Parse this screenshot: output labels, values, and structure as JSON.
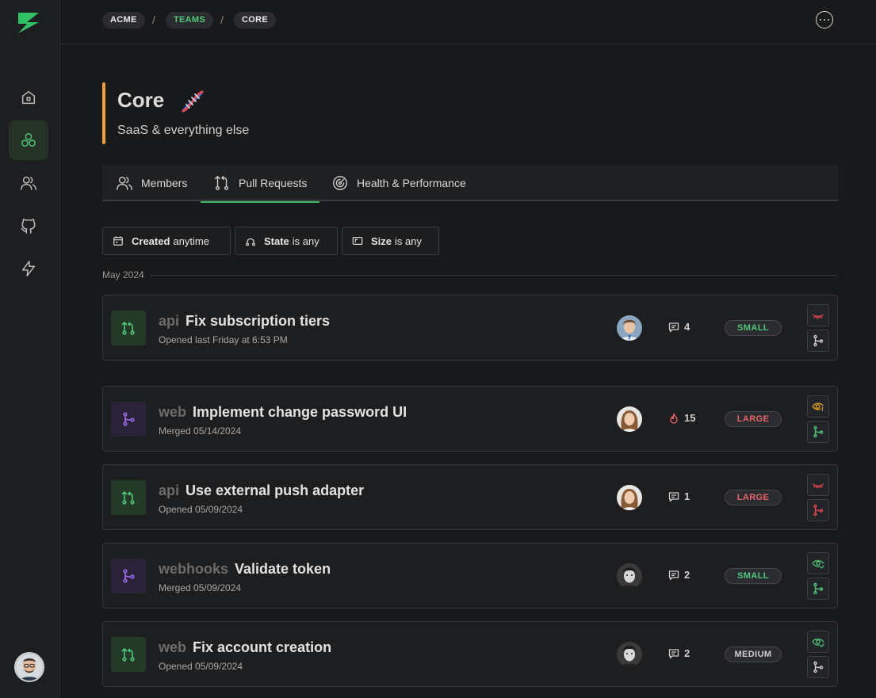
{
  "colors": {
    "accent_green": "#3fb86b",
    "title_accent": "#f2a22a",
    "open_icon": "#4ec77a",
    "merged_icon": "#9b6bf0",
    "danger": "#e2464f",
    "warning": "#e8a317"
  },
  "sidebar": {
    "logo_icon": "bolt-logo-icon",
    "items": [
      {
        "icon": "home-icon"
      },
      {
        "icon": "teams-icon",
        "active": true
      },
      {
        "icon": "users-icon"
      },
      {
        "icon": "github-icon"
      },
      {
        "icon": "lightning-icon"
      }
    ],
    "user_avatar": "user-avatar"
  },
  "breadcrumb": {
    "items": [
      "ACME",
      "TEAMS",
      "CORE"
    ],
    "separator": "/"
  },
  "header": {
    "title": "Core",
    "emoji": "dna-emoji",
    "subtitle": "SaaS & everything else"
  },
  "tabs": [
    {
      "label": "Members",
      "icon": "users-icon"
    },
    {
      "label": "Pull Requests",
      "icon": "pull-request-icon",
      "active": true
    },
    {
      "label": "Health & Performance",
      "icon": "gauge-icon"
    }
  ],
  "filters": {
    "created": {
      "key": "Created",
      "value": "anytime"
    },
    "state": {
      "key": "State",
      "value": "is any"
    },
    "size": {
      "key": "Size",
      "value": "is any"
    }
  },
  "month_label": "May 2024",
  "pull_requests": [
    {
      "repo": "api",
      "title": "Fix subscription tiers",
      "status": "open",
      "subtitle": "Opened last Friday at 6:53 PM",
      "stat_icon": "comment-icon",
      "stat": "4",
      "size": "SMALL",
      "review_icon": "eye-closed-icon",
      "review_color": "#e2464f",
      "branch_color": "#cfcfcf"
    },
    {
      "repo": "web",
      "title": "Implement change password UI",
      "status": "merged",
      "subtitle": "Merged 05/14/2024",
      "stat_icon": "flame-icon",
      "stat": "15",
      "size": "LARGE",
      "review_icon": "eye-warning-icon",
      "review_color": "#e8a317",
      "branch_color": "#4ec77a"
    },
    {
      "repo": "api",
      "title": "Use external push adapter",
      "status": "open",
      "subtitle": "Opened 05/09/2024",
      "stat_icon": "comment-icon",
      "stat": "1",
      "size": "LARGE",
      "review_icon": "eye-closed-icon",
      "review_color": "#e2464f",
      "branch_color": "#e2464f"
    },
    {
      "repo": "webhooks",
      "title": "Validate token",
      "status": "merged",
      "subtitle": "Merged 05/09/2024",
      "stat_icon": "comment-icon",
      "stat": "2",
      "size": "SMALL",
      "review_icon": "eye-check-icon",
      "review_color": "#4ec77a",
      "branch_color": "#4ec77a"
    },
    {
      "repo": "web",
      "title": "Fix account creation",
      "status": "open",
      "subtitle": "Opened 05/09/2024",
      "stat_icon": "comment-icon",
      "stat": "2",
      "size": "MEDIUM",
      "review_icon": "eye-check-icon",
      "review_color": "#4ec77a",
      "branch_color": "#cfcfcf"
    }
  ]
}
